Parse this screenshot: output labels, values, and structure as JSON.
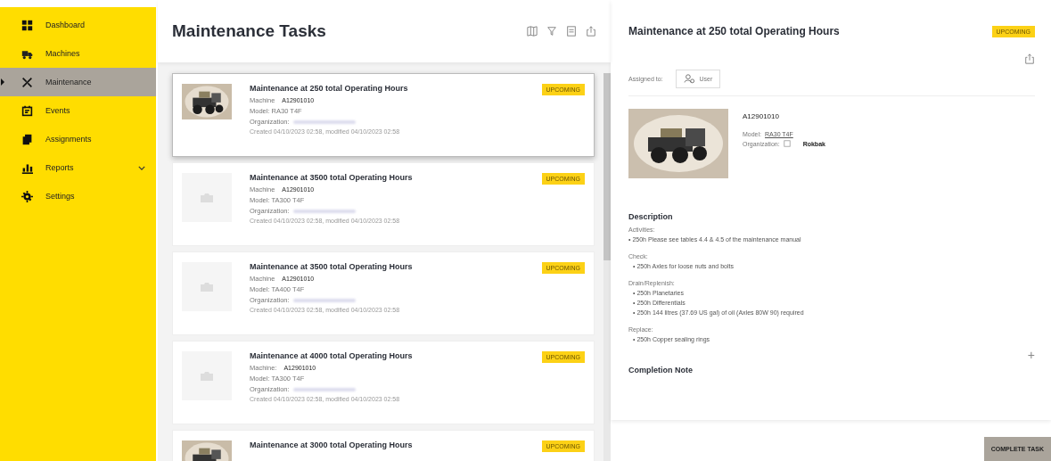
{
  "sidebar": {
    "items": [
      {
        "label": "Dashboard",
        "kind": "grid",
        "selected": false
      },
      {
        "label": "Machines",
        "kind": "truck",
        "selected": false
      },
      {
        "label": "Maintenance",
        "kind": "tools",
        "selected": true
      },
      {
        "label": "Events",
        "kind": "calendar",
        "selected": false
      },
      {
        "label": "Assignments",
        "kind": "cards",
        "selected": false
      },
      {
        "label": "Reports",
        "kind": "chart",
        "selected": false,
        "expandable": true
      },
      {
        "label": "Settings",
        "kind": "gear",
        "selected": false
      }
    ]
  },
  "list": {
    "title": "Maintenance Tasks",
    "tasks": [
      {
        "title": "Maintenance at 250 total Operating Hours",
        "badge": "UPCOMING",
        "selected": true,
        "machine_label": "Machine",
        "machine": "A12901010",
        "model": "Model: RA30 T4F",
        "organization_label": "Organization:",
        "dates": "Created 04/10/2023 02:58, modified 04/10/2023 02:58"
      },
      {
        "title": "Maintenance at 3500 total Operating Hours",
        "badge": "UPCOMING",
        "kind": "placeholder",
        "selected": false,
        "machine_label": "Machine",
        "machine": "A12901010",
        "model": "Model: TA300 T4F",
        "organization_label": "Organization:",
        "dates": "Created 04/10/2023 02:58, modified 04/10/2023 02:58"
      },
      {
        "title": "Maintenance at 3500 total Operating Hours",
        "badge": "UPCOMING",
        "kind": "placeholder",
        "selected": false,
        "machine_label": "Machine",
        "machine": "A12901010",
        "model": "Model: TA400 T4F",
        "organization_label": "Organization:",
        "dates": "Created 04/10/2023 02:58, modified 04/10/2023 02:58"
      },
      {
        "title": "Maintenance at 4000 total Operating Hours",
        "badge": "UPCOMING",
        "kind": "placeholder",
        "selected": false,
        "machine_label": "Machine:",
        "machine": "A12901010",
        "model": "Model: TA300 T4F",
        "organization_label": "Organization:",
        "dates": "Created 04/10/2023 02:58, modified 04/10/2023 02:58"
      },
      {
        "title": "Maintenance at 3000 total Operating Hours",
        "badge": "UPCOMING",
        "selected": false
      }
    ]
  },
  "detail": {
    "title": "Maintenance at 250 total Operating Hours",
    "badge": "UPCOMING",
    "assigned_label": "Assigned to:",
    "assignee": "User",
    "machine": "A12901010",
    "model_label": "Model:",
    "model": "RA30 T4F",
    "organization_label": "Organization:",
    "organization": "Rokbak",
    "description_title": "Description",
    "sections": [
      {
        "heading": "Activities:",
        "items": [
          "• 250h Please see tables 4.4 & 4.5 of the maintenance manual"
        ]
      },
      {
        "heading": "Check:",
        "items": [
          "• 250h Axles for loose nuts and bolts"
        ]
      },
      {
        "heading": "Drain/Replenish:",
        "items": [
          "• 250h Planetaries",
          "• 250h Differentials",
          "• 250h 144 litres (37.69 US gal) of oil (Axles 80W 90) required"
        ]
      },
      {
        "heading": "Replace:",
        "items": [
          "• 250h Copper sealing rings"
        ]
      }
    ],
    "completion_note": "Completion Note",
    "expand_symbol": "+",
    "complete_button": "COMPLETE TASK"
  }
}
